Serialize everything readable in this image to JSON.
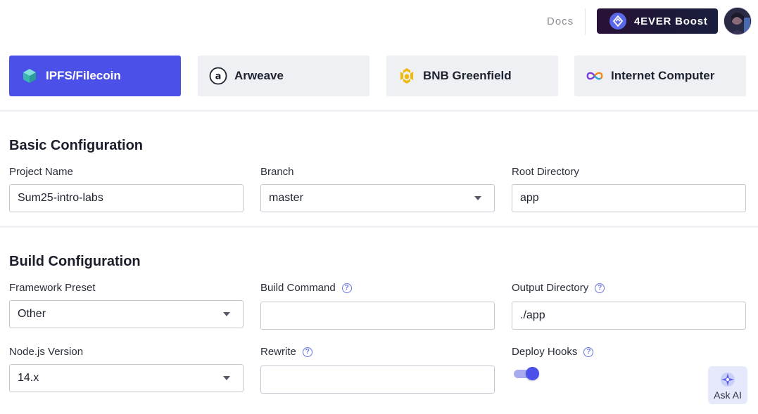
{
  "header": {
    "docs_label": "Docs",
    "boost_label": "4EVER Boost",
    "boost_icon": "4ever-logo-icon",
    "avatar": "user-avatar"
  },
  "platform_tabs": [
    {
      "label": "IPFS/Filecoin",
      "icon": "cube-icon",
      "active": true
    },
    {
      "label": "Arweave",
      "icon": "arweave-icon",
      "active": false
    },
    {
      "label": "BNB Greenfield",
      "icon": "bnb-icon",
      "active": false
    },
    {
      "label": "Internet Computer",
      "icon": "infinity-icon",
      "active": false
    }
  ],
  "basic": {
    "title": "Basic Configuration",
    "project_name_label": "Project Name",
    "project_name_value": "Sum25-intro-labs",
    "branch_label": "Branch",
    "branch_value": "master",
    "root_dir_label": "Root Directory",
    "root_dir_value": "app"
  },
  "build": {
    "title": "Build Configuration",
    "framework_label": "Framework Preset",
    "framework_value": "Other",
    "build_command_label": "Build Command",
    "build_command_value": "",
    "output_dir_label": "Output Directory",
    "output_dir_value": "./app",
    "node_label": "Node.js Version",
    "node_value": "14.x",
    "rewrite_label": "Rewrite",
    "rewrite_value": "",
    "deploy_hooks_label": "Deploy Hooks",
    "deploy_hooks_enabled": true,
    "help_glyph": "?"
  },
  "ask_ai": {
    "label": "Ask AI"
  },
  "colors": {
    "accent": "#4a50e8",
    "tab_bg": "#eef0f4"
  }
}
